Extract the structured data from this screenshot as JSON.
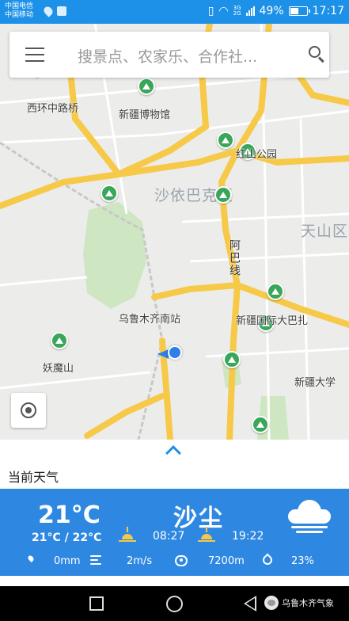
{
  "status_bar": {
    "carrier_1": "中国电信",
    "carrier_2": "中国移动",
    "network_1": "3G",
    "network_2": "2G",
    "battery": "49%",
    "battery_level": 0.49,
    "time": "17:17"
  },
  "search": {
    "placeholder": "搜景点、农家乐、合作社..."
  },
  "map": {
    "district_labels": [
      "沙依巴克区",
      "天山区"
    ],
    "road_label": "阿巴线",
    "poi_labels": [
      "西环中路桥",
      "新疆博物馆",
      "红山公园",
      "乌鲁木齐南站",
      "新疆国际大巴扎",
      "妖魔山",
      "新疆大学"
    ]
  },
  "weather": {
    "panel_title": "当前天气",
    "temperature": "21°C",
    "temp_range": "21°C / 22°C",
    "condition": "沙尘",
    "sunrise": "08:27",
    "sunset": "19:22",
    "precipitation": "0mm",
    "wind": "2m/s",
    "visibility": "7200m",
    "humidity": "23%"
  },
  "watermark": "乌鲁木齐气象",
  "colors": {
    "accent": "#1d90e8",
    "weather_bg": "#2e88e2",
    "park_green": "#3aa65a",
    "road_yellow": "#f7c948"
  }
}
